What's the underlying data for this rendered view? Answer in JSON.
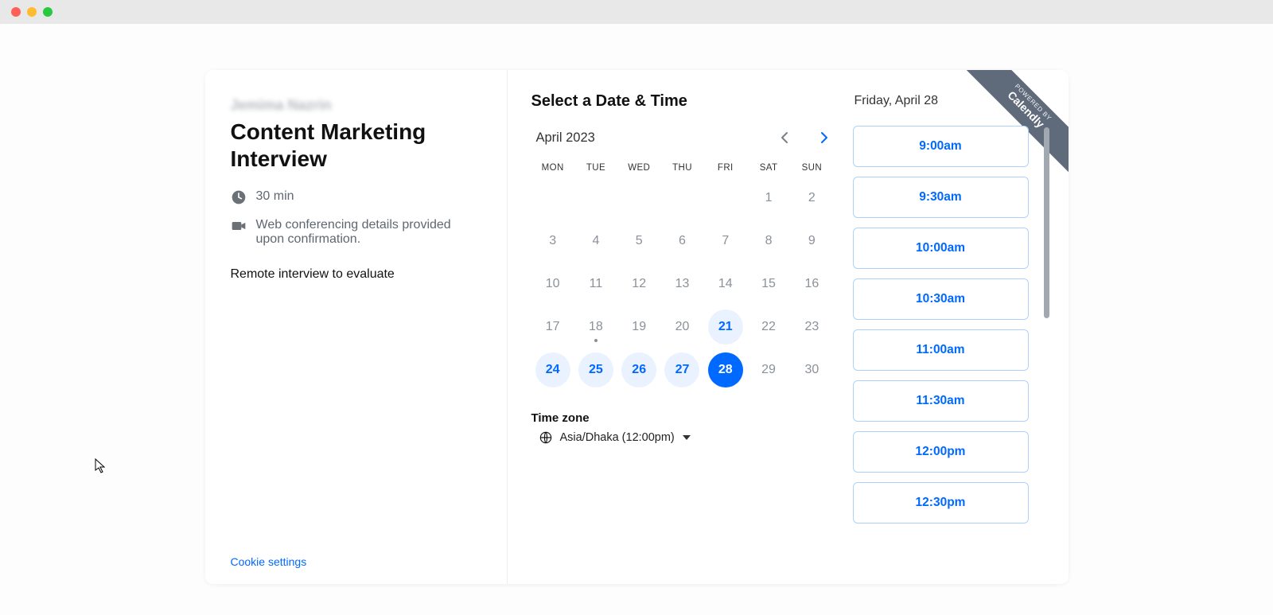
{
  "window": {
    "title": ""
  },
  "ribbon": {
    "powered": "POWERED BY",
    "brand": "Calendly"
  },
  "event": {
    "host": "Jemima Nazrin",
    "title": "Content Marketing Interview",
    "duration": "30 min",
    "location": "Web conferencing details provided upon confirmation.",
    "description": "Remote interview to evaluate"
  },
  "cookie_link": "Cookie settings",
  "booking": {
    "heading": "Select a Date & Time",
    "month_label": "April 2023",
    "dow": [
      "MON",
      "TUE",
      "WED",
      "THU",
      "FRI",
      "SAT",
      "SUN"
    ],
    "days": [
      {
        "d": "",
        "t": "empty"
      },
      {
        "d": "",
        "t": "empty"
      },
      {
        "d": "",
        "t": "empty"
      },
      {
        "d": "",
        "t": "empty"
      },
      {
        "d": "",
        "t": "empty"
      },
      {
        "d": "1",
        "t": "past"
      },
      {
        "d": "2",
        "t": "past"
      },
      {
        "d": "3",
        "t": "past"
      },
      {
        "d": "4",
        "t": "past"
      },
      {
        "d": "5",
        "t": "past"
      },
      {
        "d": "6",
        "t": "past"
      },
      {
        "d": "7",
        "t": "past"
      },
      {
        "d": "8",
        "t": "past"
      },
      {
        "d": "9",
        "t": "past"
      },
      {
        "d": "10",
        "t": "past"
      },
      {
        "d": "11",
        "t": "past"
      },
      {
        "d": "12",
        "t": "past"
      },
      {
        "d": "13",
        "t": "past"
      },
      {
        "d": "14",
        "t": "past"
      },
      {
        "d": "15",
        "t": "past"
      },
      {
        "d": "16",
        "t": "past"
      },
      {
        "d": "17",
        "t": "past"
      },
      {
        "d": "18",
        "t": "past",
        "dot": true
      },
      {
        "d": "19",
        "t": "past"
      },
      {
        "d": "20",
        "t": "past"
      },
      {
        "d": "21",
        "t": "avail"
      },
      {
        "d": "22",
        "t": "past"
      },
      {
        "d": "23",
        "t": "past"
      },
      {
        "d": "24",
        "t": "avail"
      },
      {
        "d": "25",
        "t": "avail"
      },
      {
        "d": "26",
        "t": "avail"
      },
      {
        "d": "27",
        "t": "avail"
      },
      {
        "d": "28",
        "t": "selected"
      },
      {
        "d": "29",
        "t": "past"
      },
      {
        "d": "30",
        "t": "past"
      }
    ],
    "tz_heading": "Time zone",
    "tz_value": "Asia/Dhaka (12:00pm)",
    "selected_date_label": "Friday, April 28",
    "times": [
      "9:00am",
      "9:30am",
      "10:00am",
      "10:30am",
      "11:00am",
      "11:30am",
      "12:00pm",
      "12:30pm"
    ]
  },
  "colors": {
    "accent": "#0069ff"
  }
}
